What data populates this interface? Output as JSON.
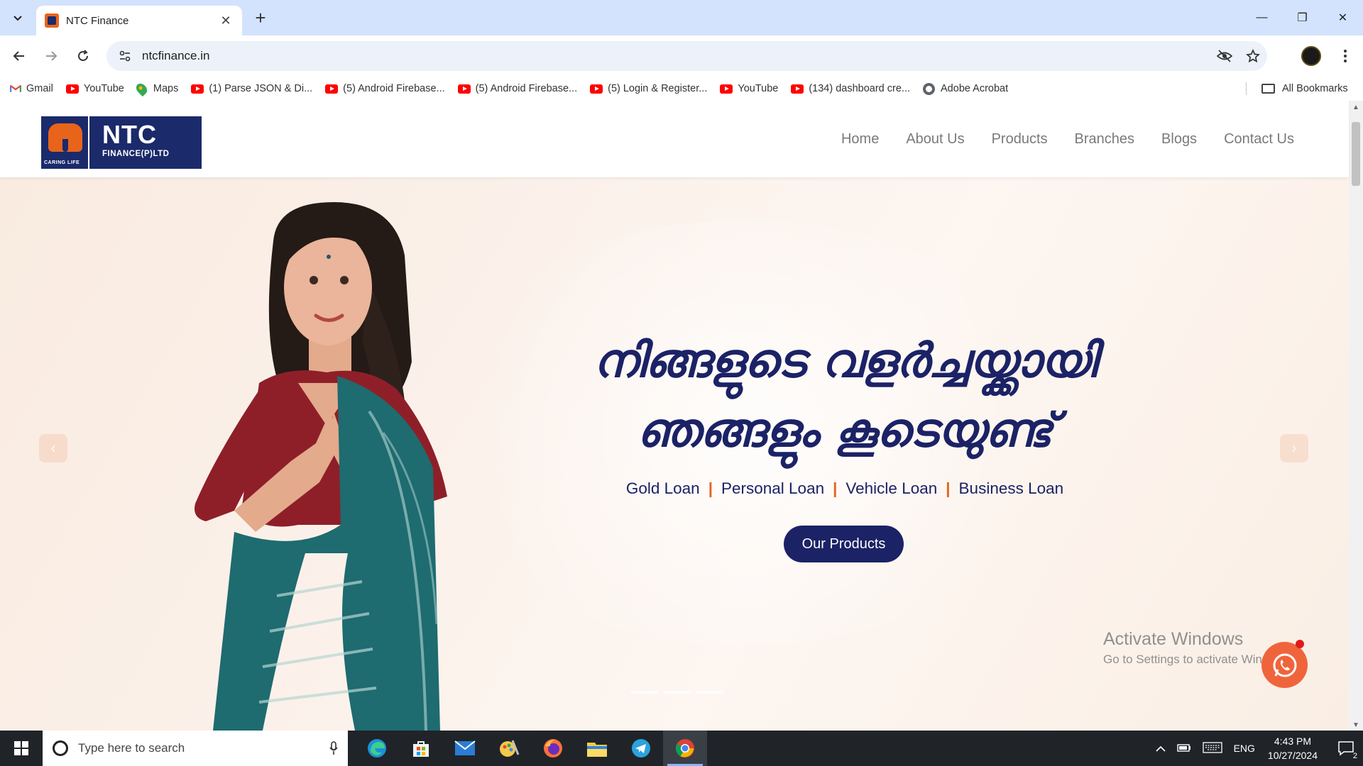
{
  "browser": {
    "tab_title": "NTC Finance",
    "tab_close": "✕",
    "new_tab": "+",
    "url": "ntcfinance.in",
    "window_controls": {
      "minimize": "—",
      "restore": "❐",
      "close": "✕"
    }
  },
  "bookmarks": {
    "items": [
      {
        "label": "Gmail",
        "icon": "gmail-icon"
      },
      {
        "label": "YouTube",
        "icon": "youtube-icon"
      },
      {
        "label": "Maps",
        "icon": "maps-icon"
      },
      {
        "label": "(1) Parse JSON & Di...",
        "icon": "youtube-icon"
      },
      {
        "label": "(5) Android Firebase...",
        "icon": "youtube-icon"
      },
      {
        "label": "(5) Android Firebase...",
        "icon": "youtube-icon"
      },
      {
        "label": "(5) Login & Register...",
        "icon": "youtube-icon"
      },
      {
        "label": "YouTube",
        "icon": "youtube-icon"
      },
      {
        "label": "(134) dashboard cre...",
        "icon": "youtube-icon"
      },
      {
        "label": "Adobe Acrobat",
        "icon": "globe-icon"
      }
    ],
    "all_bookmarks": "All Bookmarks"
  },
  "site": {
    "logo": {
      "name": "NTC",
      "sub": "FINANCE(P)LTD",
      "tagline": "CARING LIFE"
    },
    "nav": [
      "Home",
      "About Us",
      "Products",
      "Branches",
      "Blogs",
      "Contact Us"
    ],
    "hero": {
      "headline_line1": "നിങ്ങളുടെ വളർച്ചയ്ക്കായി",
      "headline_line2": "ഞങ്ങളും കൂടെയുണ്ട്",
      "loans": [
        "Gold Loan",
        "Personal Loan",
        "Vehicle Loan",
        "Business Loan"
      ],
      "loan_separator": "|",
      "cta": "Our Products",
      "prev": "‹",
      "next": "›"
    }
  },
  "watermark": {
    "line1": "Activate Windows",
    "line2": "Go to Settings to activate Windows."
  },
  "taskbar": {
    "search_placeholder": "Type here to search",
    "lang": "ENG",
    "time": "4:43 PM",
    "date": "10/27/2024",
    "notification_count": "2"
  },
  "colors": {
    "brand_navy": "#1b2266",
    "brand_orange": "#e8641b",
    "chrome_tab_strip": "#d3e3fd"
  }
}
